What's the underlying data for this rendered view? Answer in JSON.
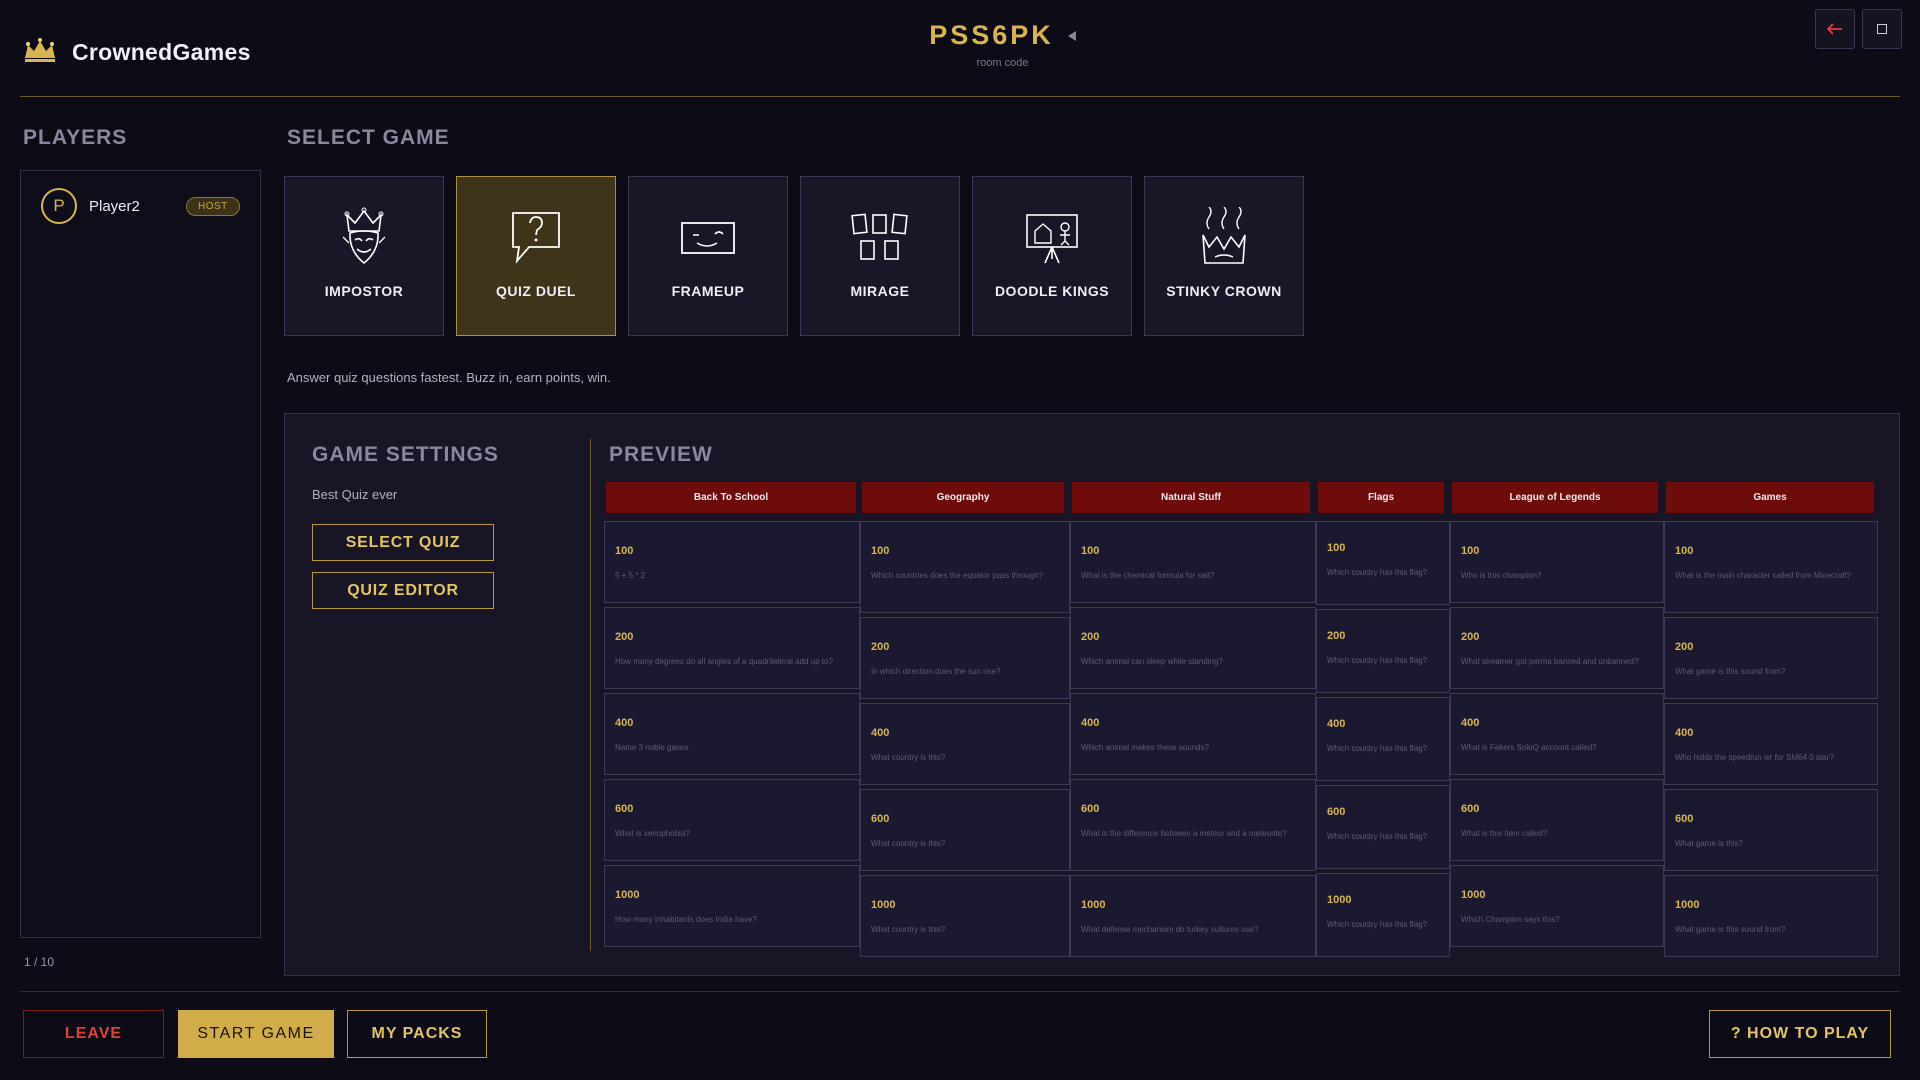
{
  "header": {
    "brand": "CrownedGames",
    "room_code": "PSS6PK",
    "room_label": "room code"
  },
  "players": {
    "title": "PLAYERS",
    "list": [
      {
        "initial": "P",
        "name": "Player2",
        "badge": "HOST"
      }
    ],
    "count": "1 / 10"
  },
  "games": {
    "title": "SELECT GAME",
    "items": [
      {
        "name": "IMPOSTOR",
        "icon": "jester-icon"
      },
      {
        "name": "QUIZ DUEL",
        "icon": "speech-bubble-question-icon",
        "selected": true
      },
      {
        "name": "FRAMEUP",
        "icon": "frame-face-icon"
      },
      {
        "name": "MIRAGE",
        "icon": "cards-icon"
      },
      {
        "name": "DOODLE KINGS",
        "icon": "easel-icon"
      },
      {
        "name": "STINKY CROWN",
        "icon": "stinky-crown-icon"
      }
    ],
    "description": "Answer quiz questions fastest. Buzz in, earn points, win."
  },
  "settings": {
    "title": "GAME SETTINGS",
    "quiz_name": "Best Quiz ever",
    "select_quiz": "SELECT QUIZ",
    "quiz_editor": "QUIZ EDITOR"
  },
  "preview": {
    "title": "PREVIEW",
    "columns": [
      {
        "category": "Back To School",
        "cells": [
          {
            "points": "100",
            "question": "5 + 5 * 2"
          },
          {
            "points": "200",
            "question": "How many degrees do all angles of a quadrilateral add up to?"
          },
          {
            "points": "400",
            "question": "Name 3 noble gases."
          },
          {
            "points": "600",
            "question": "What is xenophobia?"
          },
          {
            "points": "1000",
            "question": "How many inhabitants does India have?"
          }
        ]
      },
      {
        "category": "Geography",
        "cells": [
          {
            "points": "100",
            "question": "Which countries does the equator pass through?"
          },
          {
            "points": "200",
            "question": "In which direction does the sun rise?"
          },
          {
            "points": "400",
            "question": "What country is this?"
          },
          {
            "points": "600",
            "question": "What country is this?"
          },
          {
            "points": "1000",
            "question": "What country is this?"
          }
        ]
      },
      {
        "category": "Natural Stuff",
        "cells": [
          {
            "points": "100",
            "question": "What is the chemical formula for salt?"
          },
          {
            "points": "200",
            "question": "Which animal can sleep while standing?"
          },
          {
            "points": "400",
            "question": "Which animal makes these sounds?"
          },
          {
            "points": "600",
            "question": "What is the difference between a meteor and a meteorite?"
          },
          {
            "points": "1000",
            "question": "What defense mechanism do turkey vultures use?"
          }
        ]
      },
      {
        "category": "Flags",
        "cells": [
          {
            "points": "100",
            "question": "Which country has this flag?"
          },
          {
            "points": "200",
            "question": "Which country has this flag?"
          },
          {
            "points": "400",
            "question": "Which country has this flag?"
          },
          {
            "points": "600",
            "question": "Which country has this flag?"
          },
          {
            "points": "1000",
            "question": "Which country has this flag?"
          }
        ]
      },
      {
        "category": "League of Legends",
        "cells": [
          {
            "points": "100",
            "question": "Who is this champion?"
          },
          {
            "points": "200",
            "question": "What streamer got perma banned and unbanned?"
          },
          {
            "points": "400",
            "question": "What is Fakers SoloQ account called?"
          },
          {
            "points": "600",
            "question": "What is this item called?"
          },
          {
            "points": "1000",
            "question": "Which Champion says this?"
          }
        ]
      },
      {
        "category": "Games",
        "cells": [
          {
            "points": "100",
            "question": "What is the main character called from Minecraft?"
          },
          {
            "points": "200",
            "question": "What game is this sound from?"
          },
          {
            "points": "400",
            "question": "Who holds the speedrun wr for SM64 0 star?"
          },
          {
            "points": "600",
            "question": "What game is this?"
          },
          {
            "points": "1000",
            "question": "What game is this sound from?"
          }
        ]
      }
    ]
  },
  "footer": {
    "leave": "LEAVE",
    "start": "START GAME",
    "packs": "MY PACKS",
    "how_to_play": "? HOW TO PLAY"
  },
  "colors": {
    "accent_gold": "#d8b54f",
    "category_red": "#6e0c0c",
    "leave_red": "#e0403a",
    "background": "#0c0b16"
  }
}
